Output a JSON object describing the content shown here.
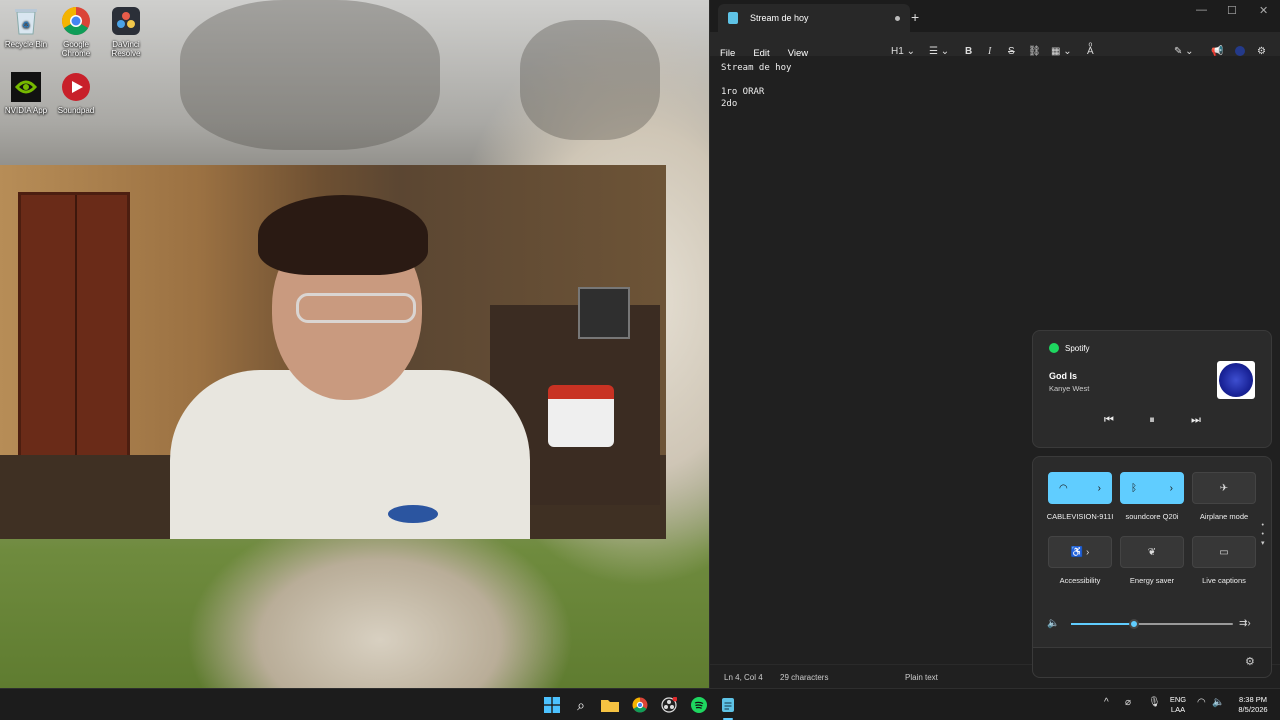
{
  "desktop": {
    "icons": [
      {
        "label": "Recycle Bin",
        "icon": "recycle-bin-icon"
      },
      {
        "label": "Google Chrome",
        "icon": "chrome-icon"
      },
      {
        "label": "DaVinci Resolve",
        "icon": "davinci-resolve-icon"
      },
      {
        "label": "NVIDIA App",
        "icon": "nvidia-icon"
      },
      {
        "label": "Soundpad",
        "icon": "soundpad-icon"
      }
    ]
  },
  "notepad": {
    "tab_title": "Stream de hoy",
    "menus": [
      "File",
      "Edit",
      "View"
    ],
    "heading_select": "H1",
    "content": "Stream de hoy\n\n1ro ORAR\n2do",
    "status": {
      "position": "Ln 4, Col 4",
      "characters": "29 characters",
      "format": "Plain text"
    }
  },
  "media": {
    "app_name": "Spotify",
    "track_title": "God Is",
    "artist": "Kanye West"
  },
  "quick_settings": {
    "tiles": [
      {
        "label": "CABLEVISION-911I",
        "icon": "wifi-icon",
        "active": true
      },
      {
        "label": "soundcore Q20i",
        "icon": "bluetooth-icon",
        "active": true
      },
      {
        "label": "Airplane mode",
        "icon": "airplane-icon",
        "active": false
      },
      {
        "label": "Accessibility",
        "icon": "accessibility-icon",
        "active": false
      },
      {
        "label": "Energy saver",
        "icon": "energy-saver-icon",
        "active": false
      },
      {
        "label": "Live captions",
        "icon": "live-captions-icon",
        "active": false
      }
    ],
    "volume_percent": 39
  },
  "taskbar": {
    "language": "ENG",
    "keyboard": "LAA",
    "time": "8:38 PM",
    "date": "8/5/2026"
  },
  "colors": {
    "accent": "#60cdff",
    "spotify": "#1ed760",
    "notepad_bg": "#202020"
  }
}
